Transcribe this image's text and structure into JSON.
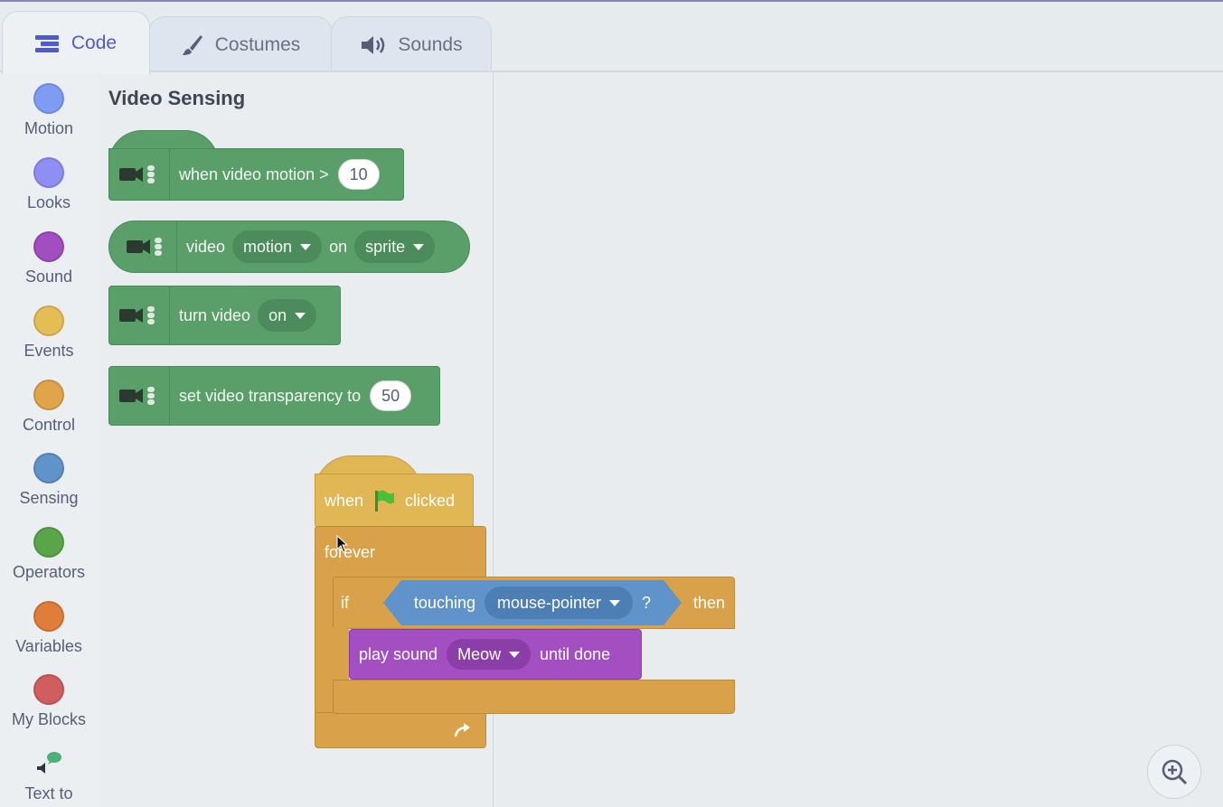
{
  "tabs": [
    {
      "label": "Code",
      "icon": "code-icon",
      "active": true
    },
    {
      "label": "Costumes",
      "icon": "brush-icon",
      "active": false
    },
    {
      "label": "Sounds",
      "icon": "speaker-icon",
      "active": false
    }
  ],
  "categories": [
    {
      "label": "Motion",
      "color": "#7f9cf5"
    },
    {
      "label": "Looks",
      "color": "#8e8ef5"
    },
    {
      "label": "Sound",
      "color": "#a04ec0"
    },
    {
      "label": "Events",
      "color": "#e5bd55"
    },
    {
      "label": "Control",
      "color": "#e0a54a"
    },
    {
      "label": "Sensing",
      "color": "#5f93c9"
    },
    {
      "label": "Operators",
      "color": "#5aa549"
    },
    {
      "label": "Variables",
      "color": "#e07d3a"
    },
    {
      "label": "My Blocks",
      "color": "#d05e5e"
    },
    {
      "label": "Text to",
      "icon": "text-to-speech-icon"
    }
  ],
  "palette": {
    "title": "Video Sensing",
    "blocks": {
      "when_motion": {
        "text": "when video motion >",
        "value": "10"
      },
      "video_on": {
        "text1": "video",
        "opt1": "motion",
        "text2": "on",
        "opt2": "sprite"
      },
      "turn_video": {
        "text": "turn video",
        "opt": "on"
      },
      "transparency": {
        "text": "set video transparency to",
        "value": "50"
      }
    }
  },
  "script": {
    "hat": {
      "when": "when",
      "clicked": "clicked"
    },
    "forever": "forever",
    "if": {
      "label": "if",
      "then": "then"
    },
    "touching": {
      "label": "touching",
      "target": "mouse-pointer",
      "q": "?"
    },
    "play_sound": {
      "text1": "play sound",
      "sound": "Meow",
      "text2": "until done"
    }
  },
  "colors": {
    "video_green": "#5a9e6a",
    "events_yellow": "#e1b654",
    "control_orange": "#d9a24a",
    "sensing_blue": "#5f93c9",
    "sound_purple": "#a34fc1",
    "active_tab": "#4f5cc7"
  }
}
